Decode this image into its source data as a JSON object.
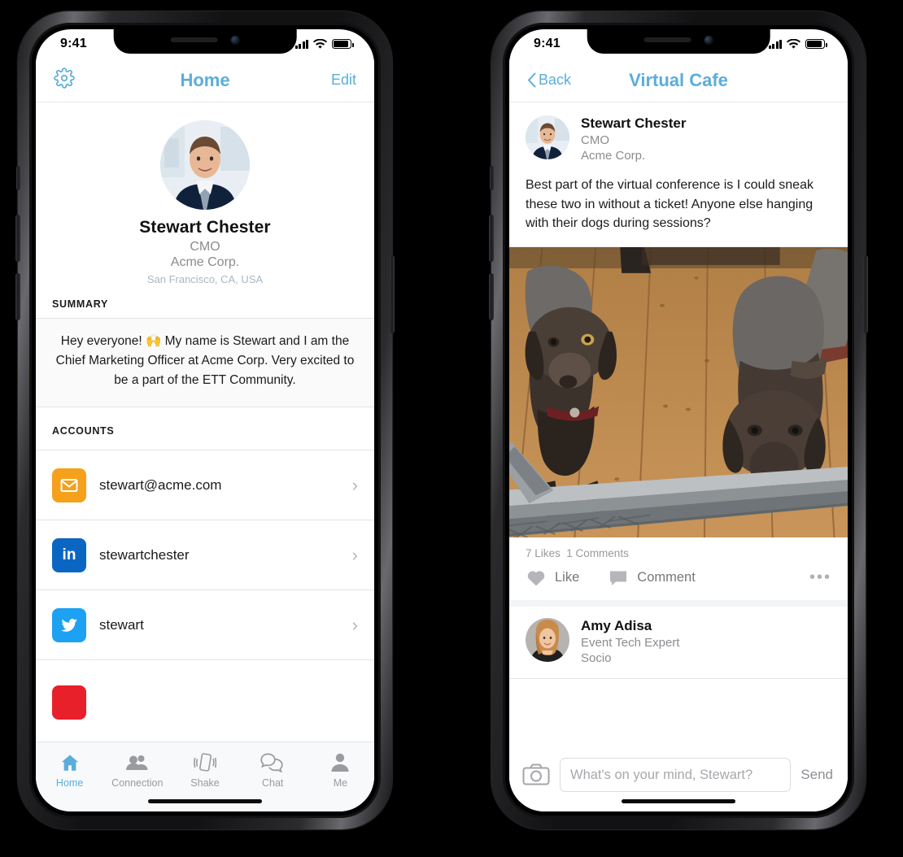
{
  "accent": "#5BADDC",
  "phone1": {
    "status": {
      "time": "9:41",
      "signal": "cellular-bars",
      "wifi": "wifi-icon",
      "battery": "battery-icon"
    },
    "nav": {
      "settings_icon": "gear-icon",
      "title": "Home",
      "edit_label": "Edit"
    },
    "profile": {
      "avatar": "profile-photo-stewart",
      "name": "Stewart Chester",
      "role": "CMO",
      "company": "Acme Corp.",
      "location": "San Francisco, CA, USA"
    },
    "summary": {
      "heading": "SUMMARY",
      "text": "Hey everyone! 🙌 My name is Stewart and I am the Chief Marketing Officer at Acme Corp. Very excited to be a part of the ETT Community."
    },
    "accounts": {
      "heading": "ACCOUNTS",
      "items": [
        {
          "icon": "email-icon",
          "color": "#F5A11B",
          "label": "stewart@acme.com",
          "chevron": "›"
        },
        {
          "icon": "linkedin-icon",
          "color": "#0A66C2",
          "label": "stewartchester",
          "chevron": "›"
        },
        {
          "icon": "twitter-icon",
          "color": "#1DA1F2",
          "label": "stewart",
          "chevron": "›"
        },
        {
          "icon": "youtube-icon",
          "color": "#E8202A",
          "label": "",
          "chevron": ""
        }
      ]
    },
    "tabs": [
      {
        "icon": "home-icon",
        "label": "Home",
        "active": true
      },
      {
        "icon": "connection-icon",
        "label": "Connection",
        "active": false
      },
      {
        "icon": "shake-icon",
        "label": "Shake",
        "active": false
      },
      {
        "icon": "chat-icon",
        "label": "Chat",
        "active": false
      },
      {
        "icon": "me-icon",
        "label": "Me",
        "active": false
      }
    ]
  },
  "phone2": {
    "status": {
      "time": "9:41",
      "signal": "cellular-bars",
      "wifi": "wifi-icon",
      "battery": "battery-icon"
    },
    "nav": {
      "back_label": "Back",
      "title": "Virtual Cafe"
    },
    "post": {
      "avatar": "profile-photo-stewart",
      "author": "Stewart Chester",
      "role": "CMO",
      "company": "Acme Corp.",
      "text": "Best part of the virtual conference is I could sneak these two in without a ticket! Anyone else hanging with their dogs during sessions?",
      "image_alt": "two-chocolate-labrador-dogs-on-wooden-deck",
      "likes": "7 Likes",
      "comments": "1 Comments",
      "like_label": "Like",
      "comment_label": "Comment",
      "more_label": "•••"
    },
    "comment": {
      "avatar": "profile-photo-amy",
      "author": "Amy Adisa",
      "role": "Event Tech Expert",
      "company": "Socio"
    },
    "composer": {
      "camera_icon": "camera-icon",
      "placeholder": "What's on your mind, Stewart?",
      "send_label": "Send"
    }
  }
}
